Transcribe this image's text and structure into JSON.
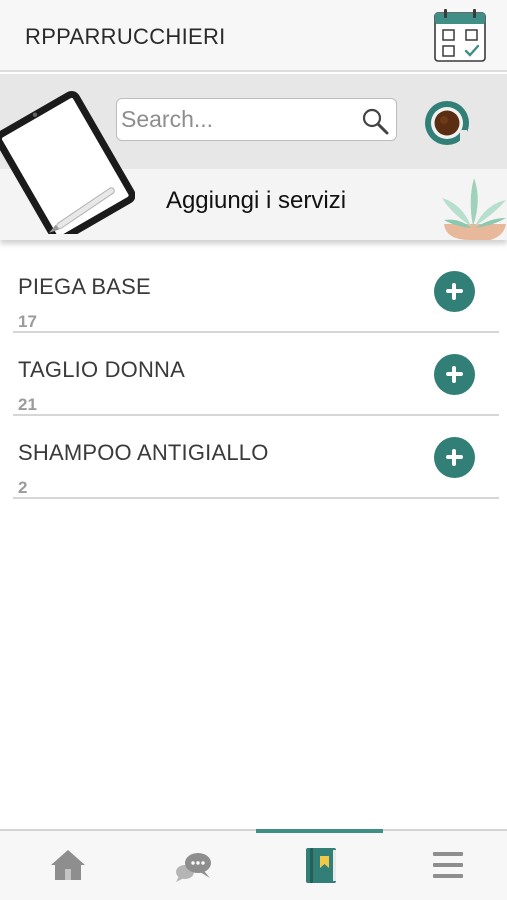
{
  "app": {
    "title": "RPPARRUCCHIERI"
  },
  "header": {
    "calendar_icon": "calendar-check-icon"
  },
  "search": {
    "placeholder": "Search...",
    "value": ""
  },
  "banner": {
    "title": "Aggiungi i servizi"
  },
  "services": [
    {
      "name": "PIEGA BASE",
      "count": "17"
    },
    {
      "name": "TAGLIO DONNA",
      "count": "21"
    },
    {
      "name": "SHAMPOO ANTIGIALLO",
      "count": "2"
    }
  ],
  "nav": {
    "items": [
      {
        "icon": "home-icon",
        "active": false
      },
      {
        "icon": "chat-icon",
        "active": false
      },
      {
        "icon": "book-icon",
        "active": true
      },
      {
        "icon": "menu-icon",
        "active": false
      }
    ]
  },
  "colors": {
    "accent": "#317f76",
    "nav_indicator": "#3f8f86",
    "header_bg": "#f7f7f7",
    "banner_bg": "#e7e7e7"
  }
}
